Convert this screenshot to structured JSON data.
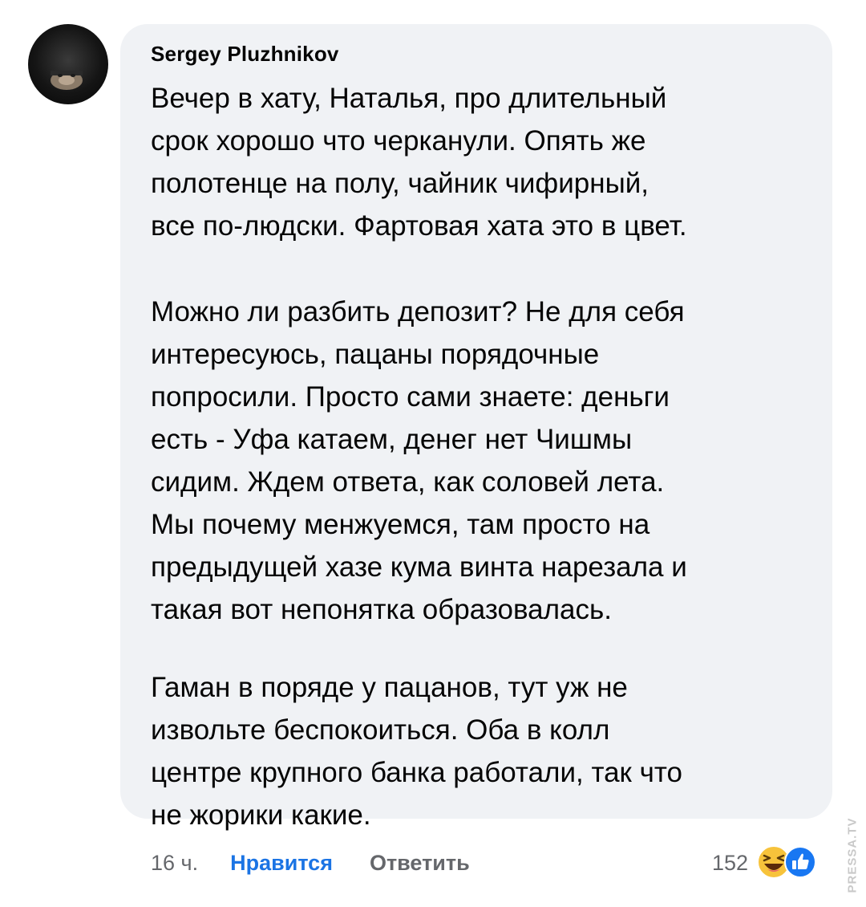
{
  "comment": {
    "author": "Sergey Pluzhnikov",
    "paragraphs": [
      "Вечер в хату, Наталья, про длительный\nсрок хорошо что черканули. Опять же\nполотенце на полу, чайник чифирный,\nвсе по-людски. Фартовая хата это в цвет.",
      "Можно ли разбить депозит? Не для себя\nинтересуюсь, пацаны порядочные\nпопросили. Просто сами знаете: деньги\nесть - Уфа катаем, денег нет Чишмы\nсидим. Ждем ответа, как соловей лета.\nМы почему менжуемся, там просто на\nпредыдущей хазе кума винта нарезала и\nтакая вот непонятка образовалась.",
      "Гаман в поряде у пацанов, тут уж не\nизвольте беспокоиться. Оба в колл\nцентре крупного банка работали, так что\nне жорики какие."
    ]
  },
  "actions": {
    "time": "16 ч.",
    "like_label": "Нравится",
    "reply_label": "Ответить"
  },
  "reactions": {
    "count": "152",
    "icons": [
      "haha-icon",
      "like-icon"
    ]
  },
  "watermark": "PRESSA.TV",
  "colors": {
    "bubble": "#f0f2f5",
    "link": "#1b74e4",
    "muted": "#65676b",
    "text": "#050505"
  }
}
